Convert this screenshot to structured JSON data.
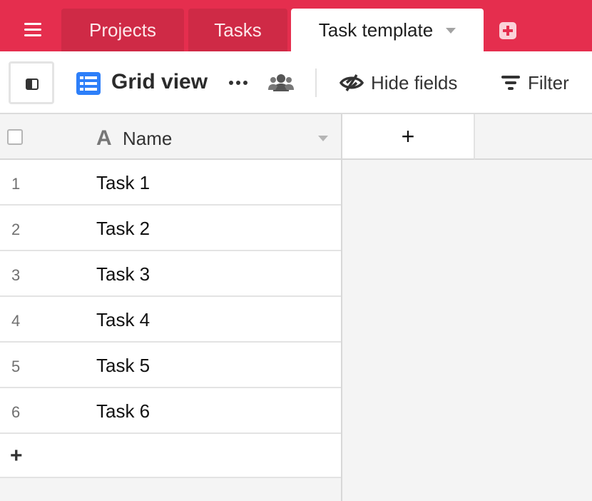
{
  "tabs": {
    "items": [
      {
        "label": "Projects",
        "active": false
      },
      {
        "label": "Tasks",
        "active": false
      },
      {
        "label": "Task template",
        "active": true
      }
    ]
  },
  "toolbar": {
    "view_name": "Grid view",
    "hide_fields_label": "Hide fields",
    "filter_label": "Filter"
  },
  "grid": {
    "primary_field": {
      "name": "Name",
      "type_icon": "A"
    },
    "add_field_symbol": "+",
    "add_row_symbol": "+",
    "rows": [
      {
        "number": "1",
        "name": "Task 1"
      },
      {
        "number": "2",
        "name": "Task 2"
      },
      {
        "number": "3",
        "name": "Task 3"
      },
      {
        "number": "4",
        "name": "Task 4"
      },
      {
        "number": "5",
        "name": "Task 5"
      },
      {
        "number": "6",
        "name": "Task 6"
      }
    ]
  },
  "colors": {
    "brand": "#e52e4e",
    "grid_view_icon": "#2d7ff9"
  }
}
